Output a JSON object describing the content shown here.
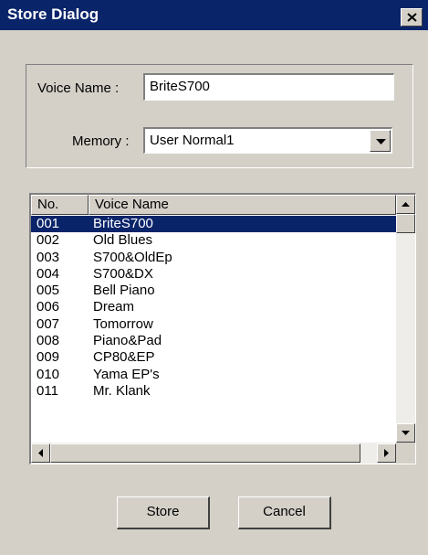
{
  "window": {
    "title": "Store Dialog"
  },
  "form": {
    "voice_name_label": "Voice Name :",
    "voice_name_value": "BriteS700",
    "memory_label": "Memory :",
    "memory_value": "User Normal1"
  },
  "list": {
    "columns": [
      "No.",
      "Voice Name"
    ],
    "rows": [
      {
        "no": "001",
        "name": "BriteS700",
        "selected": true
      },
      {
        "no": "002",
        "name": "Old Blues"
      },
      {
        "no": "003",
        "name": "S700&OldEp"
      },
      {
        "no": "004",
        "name": "S700&DX"
      },
      {
        "no": "005",
        "name": "Bell Piano"
      },
      {
        "no": "006",
        "name": "Dream"
      },
      {
        "no": "007",
        "name": "Tomorrow"
      },
      {
        "no": "008",
        "name": "Piano&Pad"
      },
      {
        "no": "009",
        "name": "CP80&EP"
      },
      {
        "no": "010",
        "name": "Yama EP's"
      },
      {
        "no": "011",
        "name": "Mr. Klank"
      }
    ]
  },
  "buttons": {
    "store": "Store",
    "cancel": "Cancel"
  },
  "colors": {
    "titlebar": "#0a246a",
    "face": "#d4d0c8",
    "selection": "#0a246a"
  }
}
